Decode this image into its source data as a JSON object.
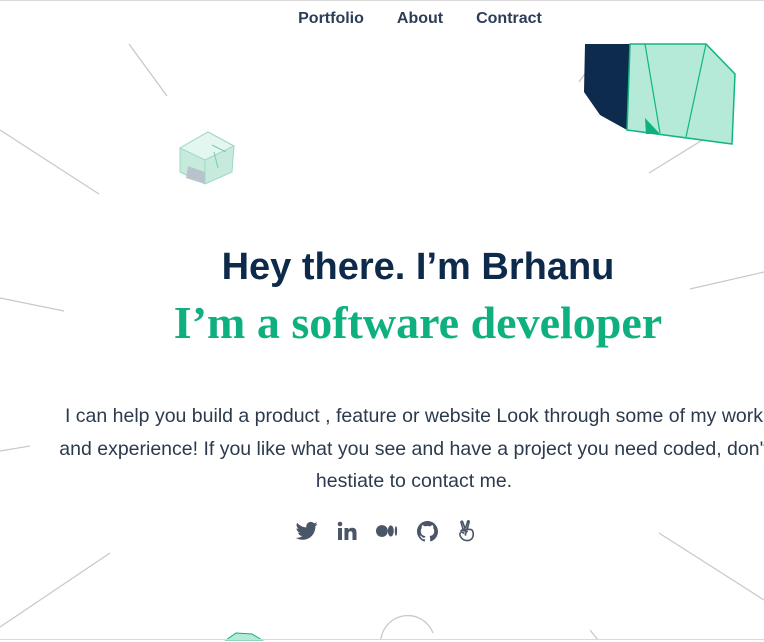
{
  "nav": {
    "items": [
      {
        "label": "Portfolio"
      },
      {
        "label": "About"
      },
      {
        "label": "Contract"
      }
    ]
  },
  "hero": {
    "title": "Hey there. I’m Brhanu",
    "subtitle": "I’m a software developer",
    "description_lines": [
      "I can help you build a product , feature or website Look through some of my work",
      "and experience! If you like what you see and have a project you need coded, don't",
      "hestiate to contact me."
    ]
  },
  "socials": [
    {
      "icon": "twitter-icon"
    },
    {
      "icon": "linkedin-icon"
    },
    {
      "icon": "medium-icon"
    },
    {
      "icon": "github-icon"
    },
    {
      "icon": "angellist-icon"
    }
  ],
  "colors": {
    "navy": "#0e2a4a",
    "green": "#0fb07f",
    "mint": "#b5e9d8",
    "icon": "#4a5668",
    "line": "#c9c9c9"
  }
}
